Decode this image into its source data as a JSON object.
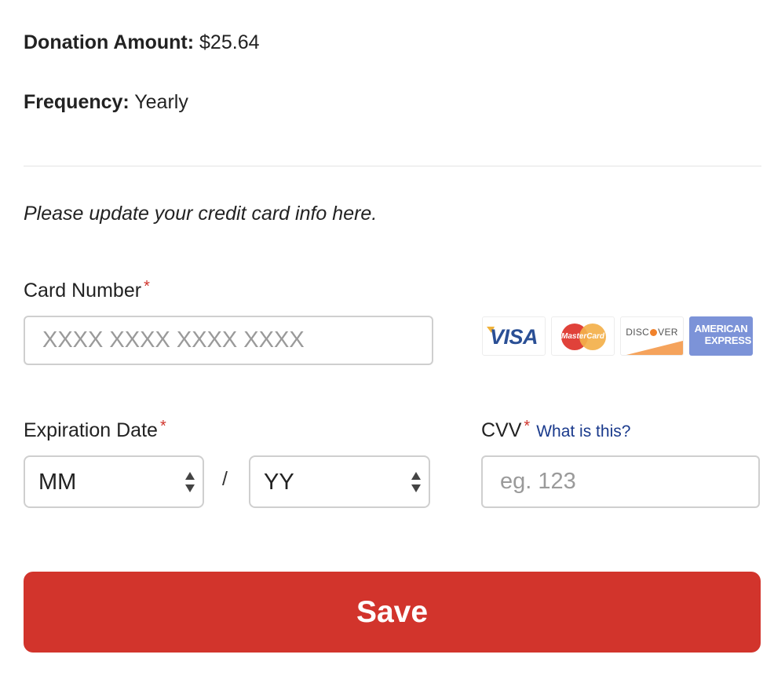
{
  "summary": {
    "amount_label": "Donation Amount:",
    "amount_value": "$25.64",
    "frequency_label": "Frequency:",
    "frequency_value": "Yearly"
  },
  "form": {
    "intro": "Please update your credit card info here.",
    "required_marker": "*",
    "card_number": {
      "label": "Card Number",
      "placeholder": "XXXX XXXX XXXX XXXX",
      "value": ""
    },
    "accepted_cards": {
      "visa": "VISA",
      "mastercard": "MasterCard",
      "discover_pre": "DISC",
      "discover_post": "VER",
      "amex_line1": "AMERICAN",
      "amex_line2": "EXPRESS"
    },
    "expiration": {
      "label": "Expiration Date",
      "month_value": "MM",
      "separator": "/",
      "year_value": "YY"
    },
    "cvv": {
      "label": "CVV",
      "help_link": "What is this?",
      "placeholder": "eg. 123",
      "value": ""
    },
    "save_label": "Save"
  },
  "colors": {
    "accent": "#d2342c",
    "link": "#1a3a8c",
    "border": "#cfcfcf"
  },
  "icons": {
    "select_arrows": "up-down-arrows-icon",
    "cards": [
      "visa-logo",
      "mastercard-logo",
      "discover-logo",
      "amex-logo"
    ]
  }
}
